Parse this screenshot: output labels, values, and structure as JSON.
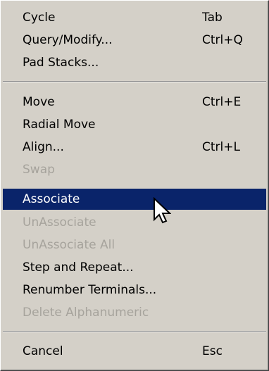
{
  "menu": {
    "groups": [
      [
        {
          "label": "Cycle",
          "shortcut": "Tab",
          "disabled": false
        },
        {
          "label": "Query/Modify...",
          "shortcut": "Ctrl+Q",
          "disabled": false
        },
        {
          "label": "Pad Stacks...",
          "shortcut": "",
          "disabled": false
        }
      ],
      [
        {
          "label": "Move",
          "shortcut": "Ctrl+E",
          "disabled": false
        },
        {
          "label": "Radial Move",
          "shortcut": "",
          "disabled": false
        },
        {
          "label": "Align...",
          "shortcut": "Ctrl+L",
          "disabled": false
        },
        {
          "label": "Swap",
          "shortcut": "",
          "disabled": true
        },
        {
          "label": "Associate",
          "shortcut": "",
          "disabled": false,
          "highlighted": true
        },
        {
          "label": "UnAssociate",
          "shortcut": "",
          "disabled": true
        },
        {
          "label": "UnAssociate All",
          "shortcut": "",
          "disabled": true
        },
        {
          "label": "Step and Repeat...",
          "shortcut": "",
          "disabled": false
        },
        {
          "label": "Renumber Terminals...",
          "shortcut": "",
          "disabled": false
        },
        {
          "label": "Delete Alphanumeric",
          "shortcut": "",
          "disabled": true
        }
      ],
      [
        {
          "label": "Cancel",
          "shortcut": "Esc",
          "disabled": false
        }
      ]
    ]
  },
  "colors": {
    "menu_bg": "#d4d0c8",
    "highlight_bg": "#0a246a",
    "highlight_text": "#ffffff",
    "disabled_text": "#a6a39c"
  },
  "icons": {
    "cursor": "arrow-pointer-icon"
  }
}
